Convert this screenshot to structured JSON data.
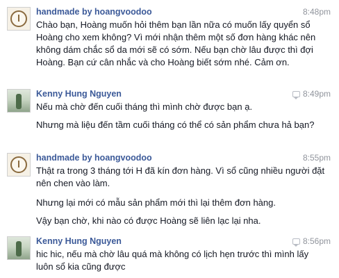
{
  "messages": [
    {
      "sender": "handmade by hoangvoodoo",
      "time": "8:48pm",
      "avatar_icon": "logo-icon",
      "paragraphs": [
        "Chào bạn, Hoàng muốn hỏi thêm bạn lần nữa có muốn lấy quyển sổ Hoàng cho xem không? Vì mới nhận thêm một số đơn hàng khác nên không dám chắc sổ da mới sẽ có sớm. Nếu bạn chờ lâu được thì đợi Hoàng. Bạn cứ cân nhắc và cho Hoàng biết sớm nhé. Cảm ơn."
      ]
    },
    {
      "sender": "Kenny Hung Nguyen",
      "time": "8:49pm",
      "avatar_icon": "user-photo",
      "paragraphs": [
        "Nếu mà chờ đến cuối tháng thì mình chờ được bạn ạ.",
        "Nhưng mà liệu đến tầm cuối tháng có thể có sản phẩm chưa hả bạn?"
      ]
    },
    {
      "sender": "handmade by hoangvoodoo",
      "time": "8:55pm",
      "avatar_icon": "logo-icon",
      "paragraphs": [
        "Thật ra trong 3 tháng tới H đã kín đơn hàng. Vì sổ cũng nhiều người đặt nên chen vào làm.",
        "Nhưng lại mới có mẫu sản phẩm mới thì lại thêm đơn hàng.",
        "Vậy bạn chờ, khi nào có được Hoàng sẽ liên lạc lại nha."
      ]
    },
    {
      "sender": "Kenny Hung Nguyen",
      "time": "8:56pm",
      "avatar_icon": "user-photo",
      "paragraphs": [
        "hic hic, nếu mà chờ lâu quá mà không có lịch hẹn trước thì mình lấy luôn sổ kia cũng được"
      ]
    }
  ]
}
